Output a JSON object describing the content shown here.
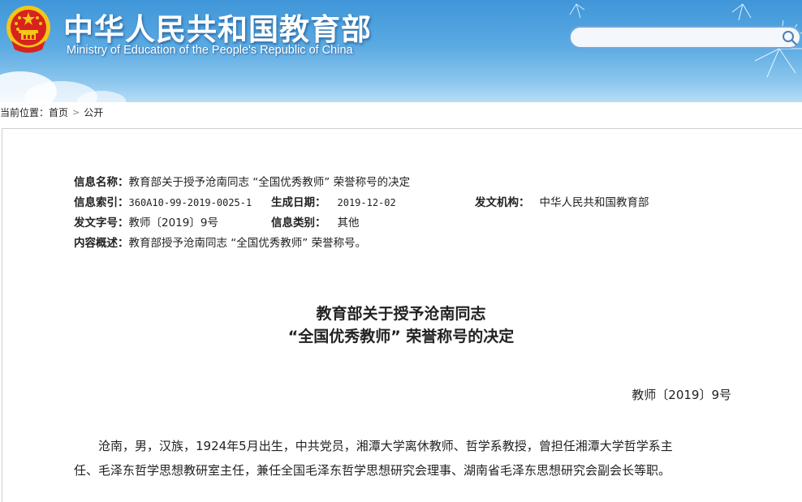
{
  "header": {
    "site_title": "中华人民共和国教育部",
    "site_subtitle": "Ministry of Education of the People's Republic of China",
    "search_placeholder": "",
    "colors": {
      "sky_top": "#3f96d8",
      "sky_bottom": "#b7dcf6",
      "emblem_red": "#d7231d",
      "emblem_gold": "#f5c518"
    }
  },
  "breadcrumb": {
    "prefix": "当前位置：",
    "items": [
      "首页",
      "公开"
    ],
    "separator": ">"
  },
  "info": {
    "name_label": "信息名称：",
    "name_value": "教育部关于授予沧南同志 “全国优秀教师” 荣誉称号的决定",
    "index_label": "信息索引：",
    "index_value": "360A10-99-2019-0025-1",
    "date_label": "生成日期：",
    "date_value": "2019-12-02",
    "org_label": "发文机构：",
    "org_value": "中华人民共和国教育部",
    "docno_label": "发文字号：",
    "docno_value": "教师〔2019〕9号",
    "category_label": "信息类别：",
    "category_value": "其他",
    "summary_label": "内容概述：",
    "summary_value": "教育部授予沧南同志 “全国优秀教师” 荣誉称号。"
  },
  "document": {
    "title_line1": "教育部关于授予沧南同志",
    "title_line2": "“全国优秀教师” 荣誉称号的决定",
    "number": "教师〔2019〕9号",
    "para1_line1": "沧南，男，汉族，1924年5月出生，中共党员，湘潭大学离休教师、哲学系教授，曾担任湘潭大学哲学系主",
    "para1_line2": "任、毛泽东哲学思想教研室主任，兼任全国毛泽东哲学思想研究会理事、湖南省毛泽东思想研究会副会长等职。"
  }
}
